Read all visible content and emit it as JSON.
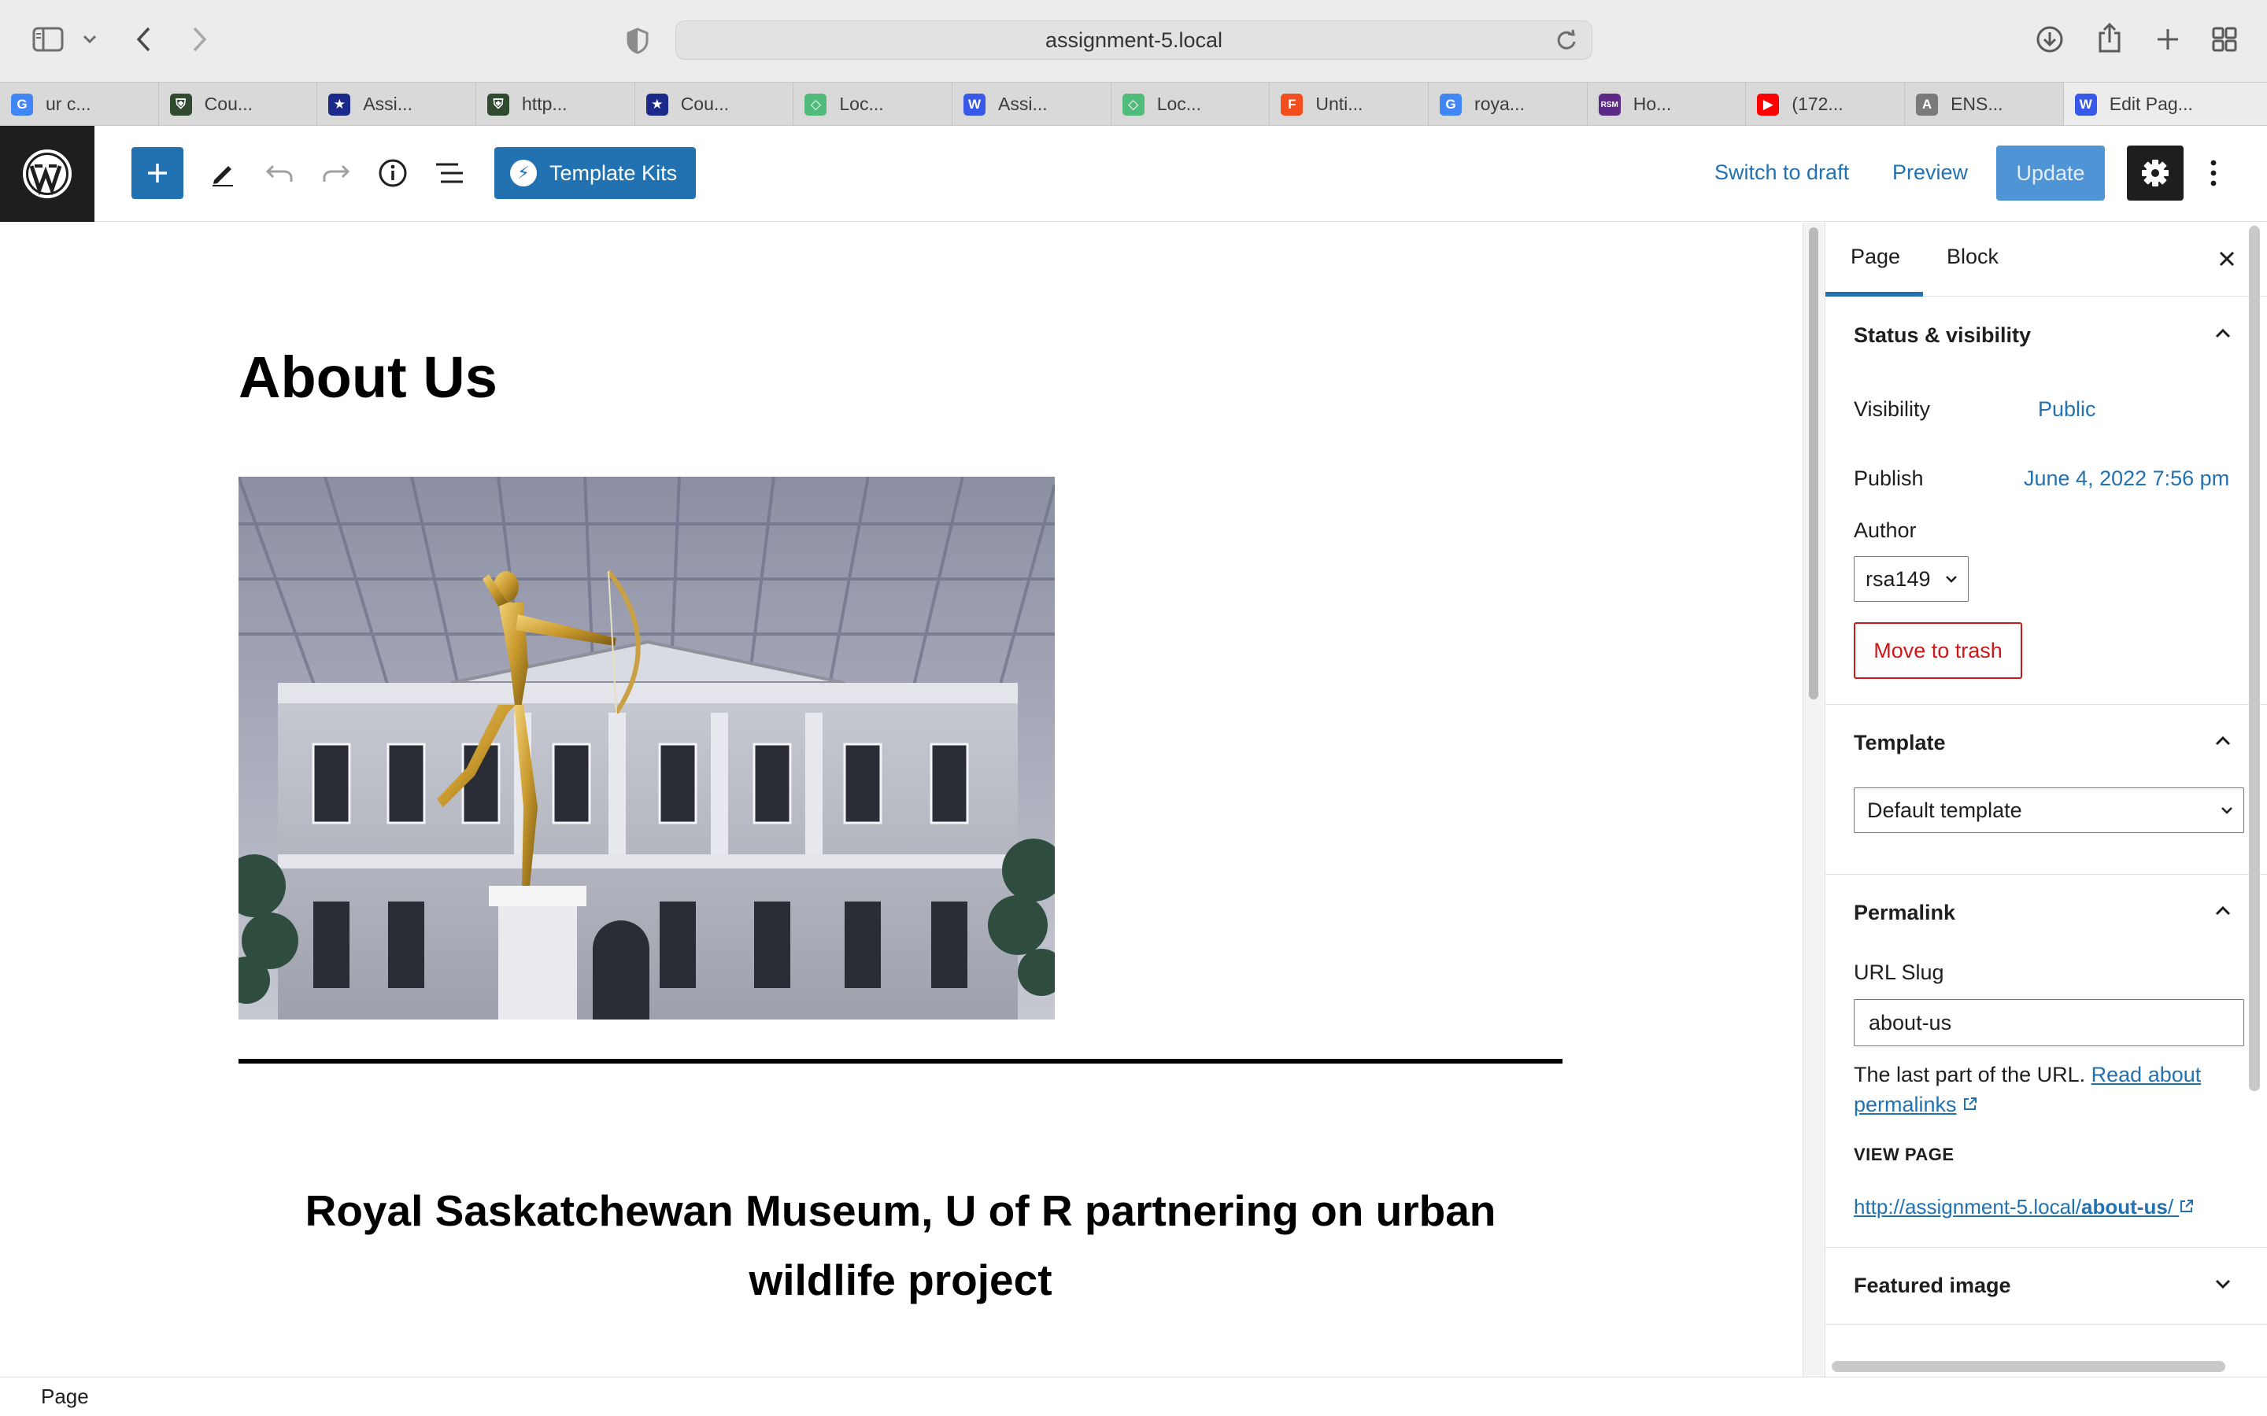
{
  "browser": {
    "address": "assignment-5.local",
    "tabs": [
      {
        "label": "ur c...",
        "icon": "google-icon",
        "color": "#4285f4",
        "glyph": "G"
      },
      {
        "label": "Cou...",
        "icon": "crest-icon",
        "color": "#2f4a2f",
        "glyph": "⛨"
      },
      {
        "label": "Assi...",
        "icon": "star-shield-icon",
        "color": "#1b2a8a",
        "glyph": "★"
      },
      {
        "label": "http...",
        "icon": "crest-icon",
        "color": "#2f4a2f",
        "glyph": "⛨"
      },
      {
        "label": "Cou...",
        "icon": "star-shield-icon",
        "color": "#1b2a8a",
        "glyph": "★"
      },
      {
        "label": "Loc...",
        "icon": "local-diamond-icon",
        "color": "#51bb7b",
        "glyph": "◇"
      },
      {
        "label": "Assi...",
        "icon": "wordpress-icon",
        "color": "#3858e9",
        "glyph": "W"
      },
      {
        "label": "Loc...",
        "icon": "local-diamond-icon",
        "color": "#51bb7b",
        "glyph": "◇"
      },
      {
        "label": "Unti...",
        "icon": "figma-icon",
        "color": "#f24e1e",
        "glyph": "F"
      },
      {
        "label": "roya...",
        "icon": "google-icon",
        "color": "#4285f4",
        "glyph": "G"
      },
      {
        "label": "Ho...",
        "icon": "rsm-icon",
        "color": "#5b2a86",
        "glyph": "RSM"
      },
      {
        "label": "(172...",
        "icon": "youtube-icon",
        "color": "#ff0000",
        "glyph": "▶"
      },
      {
        "label": "ENS...",
        "icon": "a-icon",
        "color": "#7a7a7a",
        "glyph": "A"
      }
    ],
    "active_tab": {
      "label": "Edit Pag...",
      "icon": "wordpress-icon",
      "color": "#3858e9",
      "glyph": "W"
    }
  },
  "editor": {
    "template_kits": "Template Kits",
    "switch_to_draft": "Switch to draft",
    "preview": "Preview",
    "update": "Update"
  },
  "content": {
    "title": "About Us",
    "heading": "Royal Saskatchewan Museum, U of R partnering on urban wildlife project"
  },
  "sidebar": {
    "tab_page": "Page",
    "tab_block": "Block",
    "status": {
      "title": "Status & visibility",
      "visibility_label": "Visibility",
      "visibility_value": "Public",
      "publish_label": "Publish",
      "publish_value": "June 4, 2022 7:56 pm",
      "author_label": "Author",
      "author_value": "rsa149",
      "trash": "Move to trash"
    },
    "template": {
      "title": "Template",
      "value": "Default template"
    },
    "permalink": {
      "title": "Permalink",
      "slug_label": "URL Slug",
      "slug_value": "about-us",
      "help_prefix": "The last part of the URL.",
      "help_link": "Read about permalinks",
      "view_page_label": "VIEW PAGE",
      "view_url_prefix": "http://assignment-5.local/",
      "view_url_bold": "about-us",
      "view_url_suffix": "/"
    },
    "featured_image": {
      "title": "Featured image"
    }
  },
  "footer": {
    "breadcrumb": "Page"
  }
}
